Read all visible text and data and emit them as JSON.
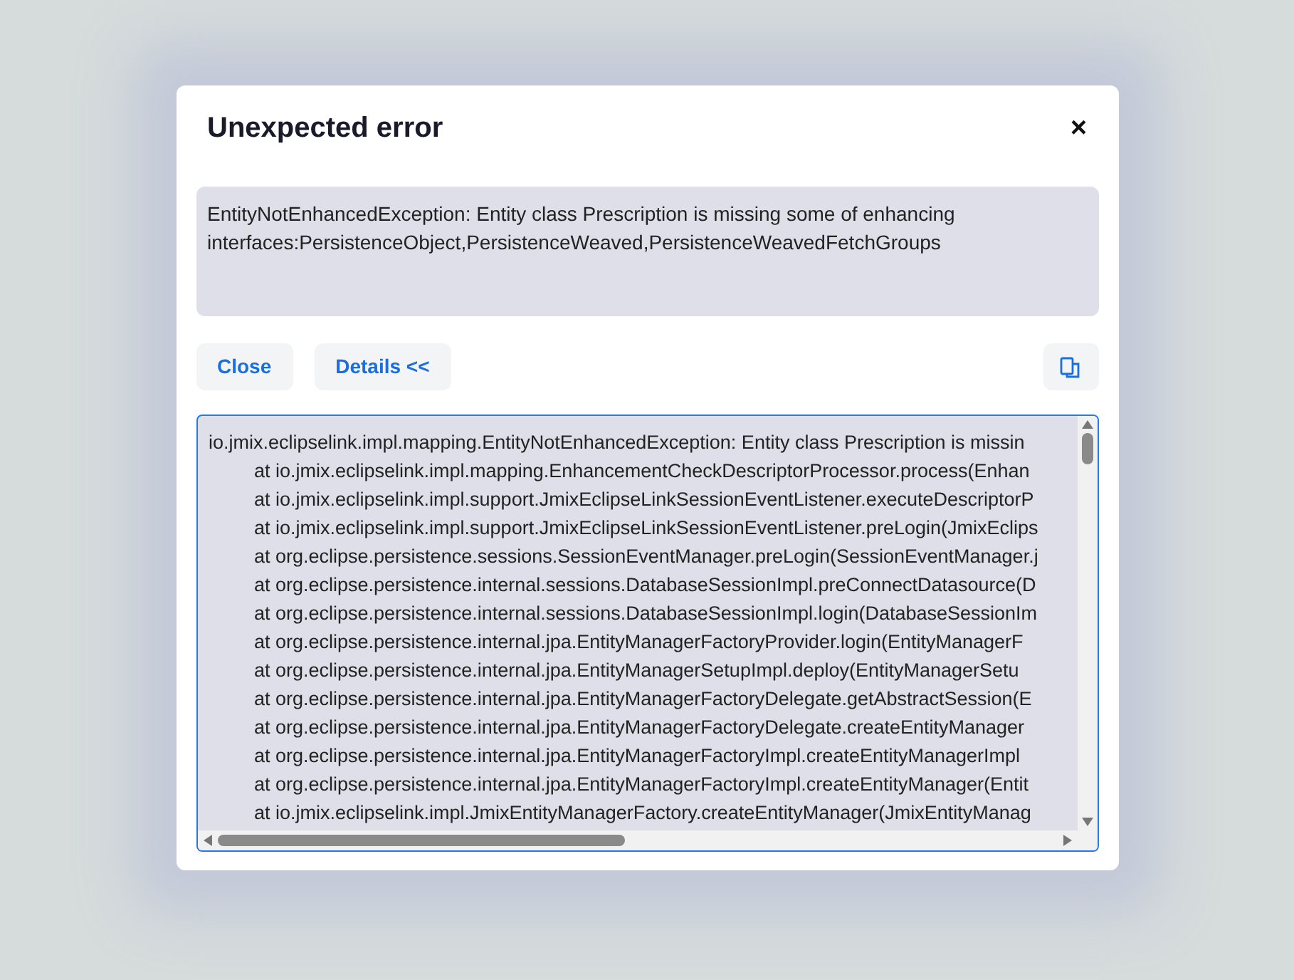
{
  "dialog": {
    "title": "Unexpected error",
    "close": "×"
  },
  "message": "EntityNotEnhancedException: Entity class Prescription is missing some of enhancing interfaces:PersistenceObject,PersistenceWeaved,PersistenceWeavedFetchGroups",
  "buttons": [
    {
      "label": "Close"
    },
    {
      "label": "Details <<"
    }
  ],
  "stack_trace": {
    "lines": [
      {
        "kind": "head",
        "text": "io.jmix.eclipselink.impl.mapping.EntityNotEnhancedException: Entity class Prescription is missin"
      },
      {
        "kind": "frame",
        "text": "at io.jmix.eclipselink.impl.mapping.EnhancementCheckDescriptorProcessor.process(Enhan"
      },
      {
        "kind": "frame",
        "text": "at io.jmix.eclipselink.impl.support.JmixEclipseLinkSessionEventListener.executeDescriptorP"
      },
      {
        "kind": "frame",
        "text": "at io.jmix.eclipselink.impl.support.JmixEclipseLinkSessionEventListener.preLogin(JmixEclips"
      },
      {
        "kind": "frame",
        "text": "at org.eclipse.persistence.sessions.SessionEventManager.preLogin(SessionEventManager.j"
      },
      {
        "kind": "frame",
        "text": "at org.eclipse.persistence.internal.sessions.DatabaseSessionImpl.preConnectDatasource(D"
      },
      {
        "kind": "frame",
        "text": "at org.eclipse.persistence.internal.sessions.DatabaseSessionImpl.login(DatabaseSessionIm"
      },
      {
        "kind": "frame",
        "text": "at org.eclipse.persistence.internal.jpa.EntityManagerFactoryProvider.login(EntityManagerF"
      },
      {
        "kind": "frame",
        "text": "at org.eclipse.persistence.internal.jpa.EntityManagerSetupImpl.deploy(EntityManagerSetu"
      },
      {
        "kind": "frame",
        "text": "at org.eclipse.persistence.internal.jpa.EntityManagerFactoryDelegate.getAbstractSession(E"
      },
      {
        "kind": "frame",
        "text": "at org.eclipse.persistence.internal.jpa.EntityManagerFactoryDelegate.createEntityManager"
      },
      {
        "kind": "frame",
        "text": "at org.eclipse.persistence.internal.jpa.EntityManagerFactoryImpl.createEntityManagerImpl"
      },
      {
        "kind": "frame",
        "text": "at org.eclipse.persistence.internal.jpa.EntityManagerFactoryImpl.createEntityManager(Entit"
      },
      {
        "kind": "frame",
        "text": "at io.jmix.eclipselink.impl.JmixEntityManagerFactory.createEntityManager(JmixEntityManag"
      }
    ]
  }
}
